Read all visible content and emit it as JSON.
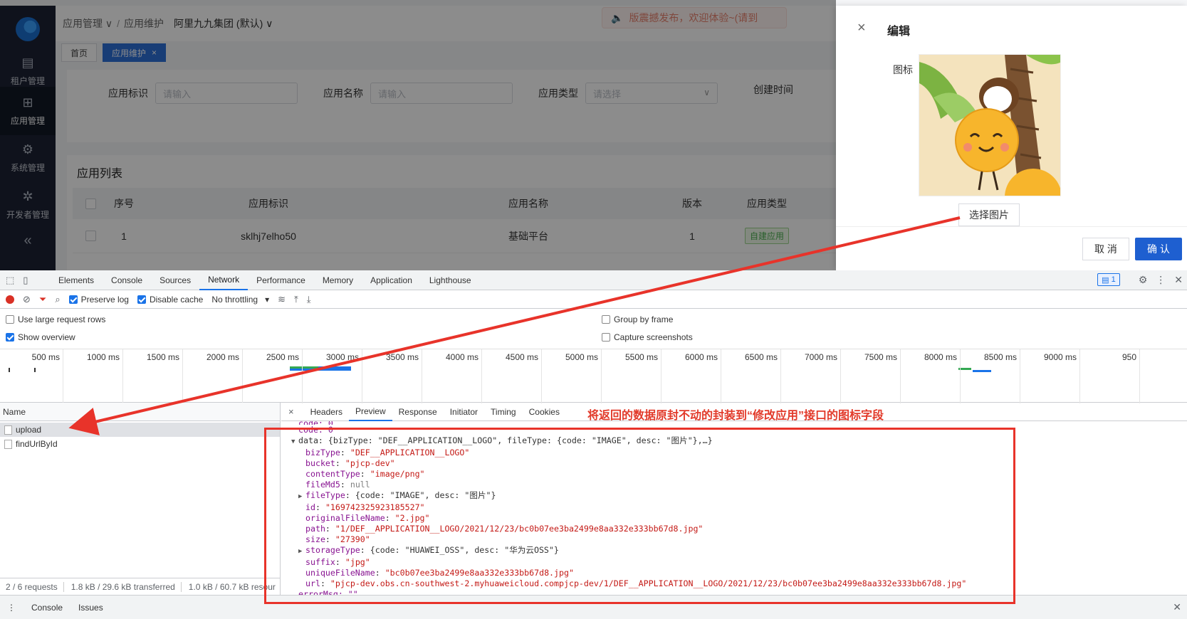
{
  "sidebar": {
    "items": [
      {
        "label": "租户管理",
        "icon": "tenant-icon",
        "active": false
      },
      {
        "label": "应用管理",
        "icon": "apps-icon",
        "active": true
      },
      {
        "label": "系统管理",
        "icon": "gear-icon",
        "active": false
      },
      {
        "label": "开发者管理",
        "icon": "bug-icon",
        "active": false
      }
    ],
    "collapse": "«"
  },
  "header": {
    "crumb1": "应用管理 ∨",
    "sep": "/",
    "crumb2": "应用维护",
    "org": "阿里九九集团 (默认) ∨",
    "notice": "版震撼发布，欢迎体验~(请到"
  },
  "tabs": [
    {
      "label": "首页"
    },
    {
      "label": "应用维护",
      "close": "×"
    }
  ],
  "search": {
    "app_id_label": "应用标识",
    "app_id_placeholder": "请输入",
    "app_name_label": "应用名称",
    "app_name_placeholder": "请输入",
    "app_type_label": "应用类型",
    "app_type_placeholder": "请选择",
    "created_label": "创建时间"
  },
  "list": {
    "title": "应用列表",
    "columns": [
      "序号",
      "应用标识",
      "应用名称",
      "版本",
      "应用类型"
    ],
    "rows": [
      {
        "index": "1",
        "app_id": "sklhj7elho50",
        "name": "基础平台",
        "version": "1",
        "type": "自建应用"
      }
    ]
  },
  "drawer": {
    "close": "×",
    "title": "编辑",
    "icon_label": "图标",
    "pick_button": "选择图片",
    "cancel": "取 消",
    "confirm": "确 认"
  },
  "devtools": {
    "tabs": [
      "Elements",
      "Console",
      "Sources",
      "Network",
      "Performance",
      "Memory",
      "Application",
      "Lighthouse"
    ],
    "active_tab": "Network",
    "badge": "1",
    "toolbar": {
      "preserve_log": "Preserve log",
      "disable_cache": "Disable cache",
      "throttling": "No throttling"
    },
    "options": {
      "large_rows": "Use large request rows",
      "show_overview": "Show overview",
      "group_by_frame": "Group by frame",
      "capture_screenshots": "Capture screenshots"
    },
    "ticks": [
      "500 ms",
      "1000 ms",
      "1500 ms",
      "2000 ms",
      "2500 ms",
      "3000 ms",
      "3500 ms",
      "4000 ms",
      "4500 ms",
      "5000 ms",
      "5500 ms",
      "6000 ms",
      "6500 ms",
      "7000 ms",
      "7500 ms",
      "8000 ms",
      "8500 ms",
      "9000 ms",
      "950"
    ],
    "name_header": "Name",
    "requests": [
      "upload",
      "findUrlById"
    ],
    "status": [
      "2 / 6 requests",
      "1.8 kB / 29.6 kB transferred",
      "1.0 kB / 60.7 kB resour"
    ],
    "detail_tabs": [
      "Headers",
      "Preview",
      "Response",
      "Initiator",
      "Timing",
      "Cookies"
    ],
    "detail_active": "Preview",
    "detail_close": "×",
    "annotation": "将返回的数据原封不动的封装到“修改应用”接口的图标字段",
    "bottom_tabs": [
      "Console",
      "Issues"
    ]
  },
  "preview": {
    "code_line": "code: 0",
    "data_summary": "data: {bizType: \"DEF__APPLICATION__LOGO\", fileType: {code: \"IMAGE\", desc: \"图片\"},…}",
    "fields": [
      {
        "k": "bizType",
        "v": "\"DEF__APPLICATION__LOGO\"",
        "t": "s"
      },
      {
        "k": "bucket",
        "v": "\"pjcp-dev\"",
        "t": "s"
      },
      {
        "k": "contentType",
        "v": "\"image/png\"",
        "t": "s"
      },
      {
        "k": "fileMd5",
        "v": "null",
        "t": "nl"
      },
      {
        "k": "fileType",
        "v": "{code: \"IMAGE\", desc: \"图片\"}",
        "t": "o"
      },
      {
        "k": "id",
        "v": "\"169742325923185527\"",
        "t": "s"
      },
      {
        "k": "originalFileName",
        "v": "\"2.jpg\"",
        "t": "s"
      },
      {
        "k": "path",
        "v": "\"1/DEF__APPLICATION__LOGO/2021/12/23/bc0b07ee3ba2499e8aa332e333bb67d8.jpg\"",
        "t": "s"
      },
      {
        "k": "size",
        "v": "\"27390\"",
        "t": "s"
      },
      {
        "k": "storageType",
        "v": "{code: \"HUAWEI_OSS\", desc: \"华为云OSS\"}",
        "t": "o"
      },
      {
        "k": "suffix",
        "v": "\"jpg\"",
        "t": "s"
      },
      {
        "k": "uniqueFileName",
        "v": "\"bc0b07ee3ba2499e8aa332e333bb67d8.jpg\"",
        "t": "s"
      },
      {
        "k": "url",
        "v": "\"pjcp-dev.obs.cn-southwest-2.myhuaweicloud.compjcp-dev/1/DEF__APPLICATION__LOGO/2021/12/23/bc0b07ee3ba2499e8aa332e333bb67d8.jpg\"",
        "t": "s"
      }
    ],
    "error_line": "errorMsg: \"\""
  },
  "colors": {
    "accent": "#1e5fd0",
    "annotation": "#e23a2a",
    "sidebar": "#1c2233"
  }
}
